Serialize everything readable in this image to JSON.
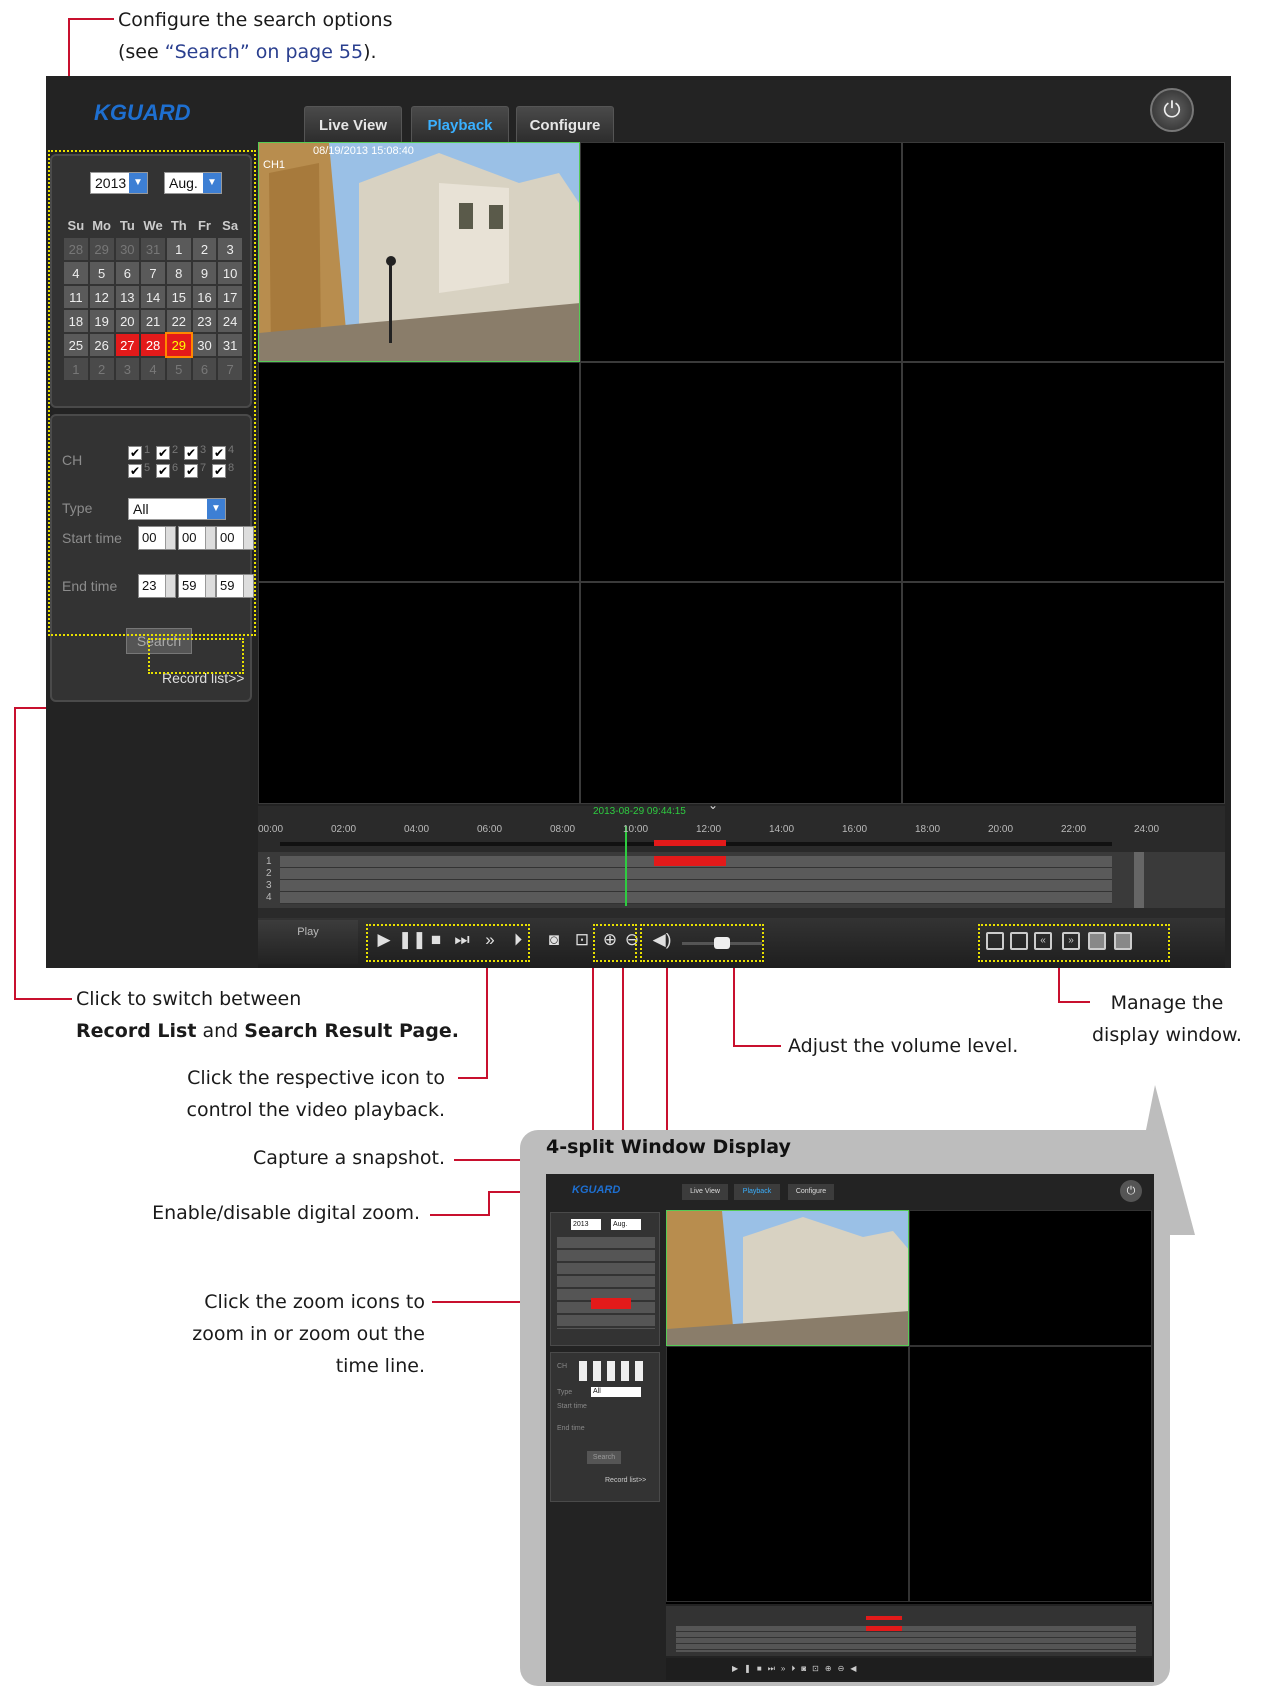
{
  "annotations": {
    "search_options_l1": "Configure the search options",
    "search_options_l2_pre": "(see ",
    "search_options_l2_link": "“Search” on page 55",
    "search_options_l2_post": ").",
    "record_switch_l1": "Click to switch between",
    "record_switch_b1": "Record List",
    "record_switch_and": " and ",
    "record_switch_b2": "Search Result Page.",
    "playback_l1": "Click the respective icon to",
    "playback_l2": "control the video playback.",
    "snapshot": "Capture a snapshot.",
    "digital_zoom": "Enable/disable digital zoom.",
    "zoom_l1": "Click the zoom icons to",
    "zoom_l2": "zoom in or zoom out the",
    "zoom_l3": "time line.",
    "volume": "Adjust the volume level.",
    "display_l1": "Manage the",
    "display_l2": "display window.",
    "four_split": "4-split Window Display"
  },
  "app": {
    "logo": "KGUARD",
    "tabs": [
      {
        "label": "Live View",
        "active": false
      },
      {
        "label": "Playback",
        "active": true
      },
      {
        "label": "Configure",
        "active": false
      }
    ],
    "calendar": {
      "year": "2013",
      "month": "Aug.",
      "weekdays": [
        "Su",
        "Mo",
        "Tu",
        "We",
        "Th",
        "Fr",
        "Sa"
      ],
      "weeks": [
        [
          "28",
          "29",
          "30",
          "31",
          "1",
          "2",
          "3"
        ],
        [
          "4",
          "5",
          "6",
          "7",
          "8",
          "9",
          "10"
        ],
        [
          "11",
          "12",
          "13",
          "14",
          "15",
          "16",
          "17"
        ],
        [
          "18",
          "19",
          "20",
          "21",
          "22",
          "23",
          "24"
        ],
        [
          "25",
          "26",
          "27",
          "28",
          "29",
          "30",
          "31"
        ],
        [
          "1",
          "2",
          "3",
          "4",
          "5",
          "6",
          "7"
        ]
      ],
      "recorded_days": [
        "27",
        "28"
      ],
      "today": "29"
    },
    "search": {
      "ch_label": "CH",
      "channels": [
        "1",
        "2",
        "3",
        "4",
        "5",
        "6",
        "7",
        "8"
      ],
      "type_label": "Type",
      "type_value": "All",
      "start_label": "Start time",
      "start": [
        "00",
        "00",
        "00"
      ],
      "end_label": "End time",
      "end": [
        "23",
        "59",
        "59"
      ],
      "search_button": "Search",
      "record_list": "Record list>>"
    },
    "video": {
      "timestamp": "08/19/2013 15:08:40",
      "channel": "CH1"
    },
    "timeline": {
      "cursor": "2013-08-29 09:44:15",
      "ticks": [
        "00:00",
        "02:00",
        "04:00",
        "06:00",
        "08:00",
        "10:00",
        "12:00",
        "14:00",
        "16:00",
        "18:00",
        "20:00",
        "22:00",
        "24:00"
      ],
      "rows": [
        "1",
        "2",
        "3",
        "4"
      ]
    },
    "controls": {
      "play_label": "Play"
    }
  }
}
